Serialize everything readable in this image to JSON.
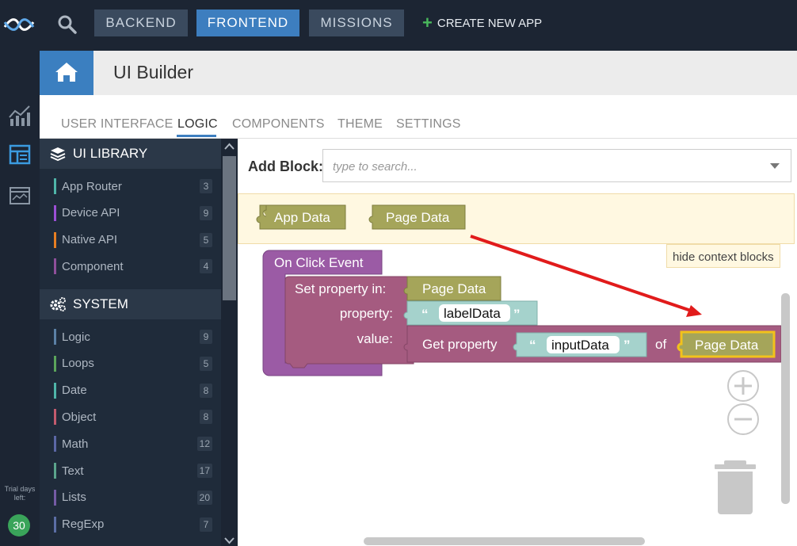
{
  "topbar": {
    "nav": [
      "BACKEND",
      "FRONTEND",
      "MISSIONS"
    ],
    "active": "FRONTEND",
    "create_app": "CREATE NEW APP",
    "accent": "#3d7ebf"
  },
  "rail": {
    "icons": [
      "analytics-icon",
      "ui-builder-icon",
      "preview-icon"
    ],
    "trial_label": "Trial days left:",
    "trial_days": "30"
  },
  "header": {
    "title": "UI Builder"
  },
  "tabs": [
    "USER INTERFACE",
    "LOGIC",
    "COMPONENTS",
    "THEME",
    "SETTINGS"
  ],
  "active_tab": "LOGIC",
  "library": {
    "ui_library": {
      "title": "UI LIBRARY",
      "items": [
        {
          "label": "App Router",
          "count": "3",
          "color": "#4fb5a9"
        },
        {
          "label": "Device API",
          "count": "9",
          "color": "#9c4fd6"
        },
        {
          "label": "Native API",
          "count": "5",
          "color": "#e67e22"
        },
        {
          "label": "Component",
          "count": "4",
          "color": "#8e4f9a"
        }
      ]
    },
    "system": {
      "title": "SYSTEM",
      "items": [
        {
          "label": "Logic",
          "count": "9",
          "color": "#5b80a5"
        },
        {
          "label": "Loops",
          "count": "5",
          "color": "#5ba55b"
        },
        {
          "label": "Date",
          "count": "8",
          "color": "#4fb5a9"
        },
        {
          "label": "Object",
          "count": "8",
          "color": "#c25b6e"
        },
        {
          "label": "Math",
          "count": "12",
          "color": "#5b67a5"
        },
        {
          "label": "Text",
          "count": "17",
          "color": "#5ba58c"
        },
        {
          "label": "Lists",
          "count": "20",
          "color": "#745ba5"
        },
        {
          "label": "RegExp",
          "count": "7",
          "color": "#5b6ea5"
        }
      ]
    }
  },
  "workspace": {
    "add_block_label": "Add Block:",
    "search_placeholder": "type to search...",
    "context_blocks": [
      "App Data",
      "Page Data"
    ],
    "hide_context": "hide context blocks",
    "event": {
      "title": "On Click Event",
      "set_label": "Set property in:",
      "set_target": "Page Data",
      "property_label": "property:",
      "property_value": "labelData",
      "value_label": "value:",
      "get_label": "Get property",
      "get_value": "inputData",
      "of_label": "of",
      "of_target": "Page Data"
    },
    "colors": {
      "event": "#9b5ba5",
      "set": "#a55b80",
      "data": "#a5a55a",
      "text": "#a5d2cc",
      "highlight": "#f2c21b",
      "arrow": "#e11b1b"
    }
  }
}
